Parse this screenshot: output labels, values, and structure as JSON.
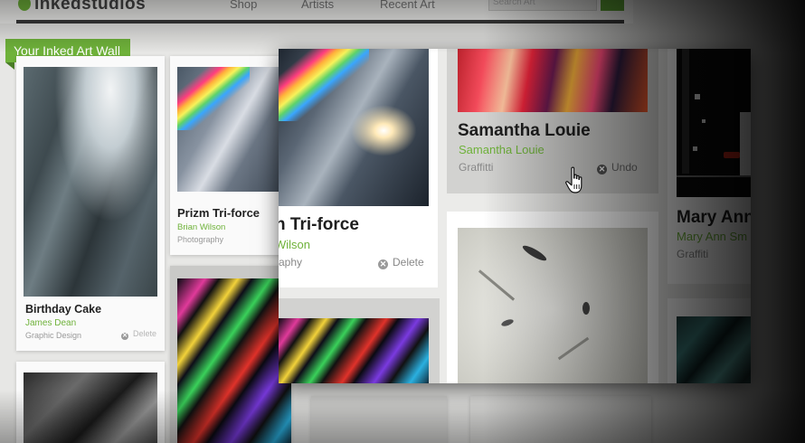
{
  "header": {
    "logo": "inkedstudios",
    "nav": [
      "Shop",
      "Artists",
      "Recent Art"
    ],
    "search_placeholder": "Search Art"
  },
  "ribbon": "Your Inked Art Wall",
  "background_cards": [
    {
      "title": "Birthday Cake",
      "artist": "James Dean",
      "category": "Graphic Design",
      "delete": "Delete"
    },
    {
      "title": "Prizm Tri-force",
      "artist": "Brian Wilson",
      "category": "Photography"
    },
    {
      "title": "Mary Ann",
      "artist": "Mary Ann Sm",
      "category": "Graffiti"
    }
  ],
  "panel": {
    "left_card": {
      "title": "n Tri-force",
      "artist": "Wilson",
      "category": "raphy",
      "delete": "Delete"
    },
    "selected_card": {
      "title": "Samantha Louie",
      "artist": "Samantha Louie",
      "category": "Graffitti",
      "undo": "Undo"
    },
    "right_card": {
      "title": "Mary Ann",
      "artist": "Mary Ann Sm",
      "category": "Graffiti"
    }
  },
  "colors": {
    "accent_green": "#6fb23a",
    "dark_text": "#1e1e1e",
    "muted": "#888888"
  }
}
